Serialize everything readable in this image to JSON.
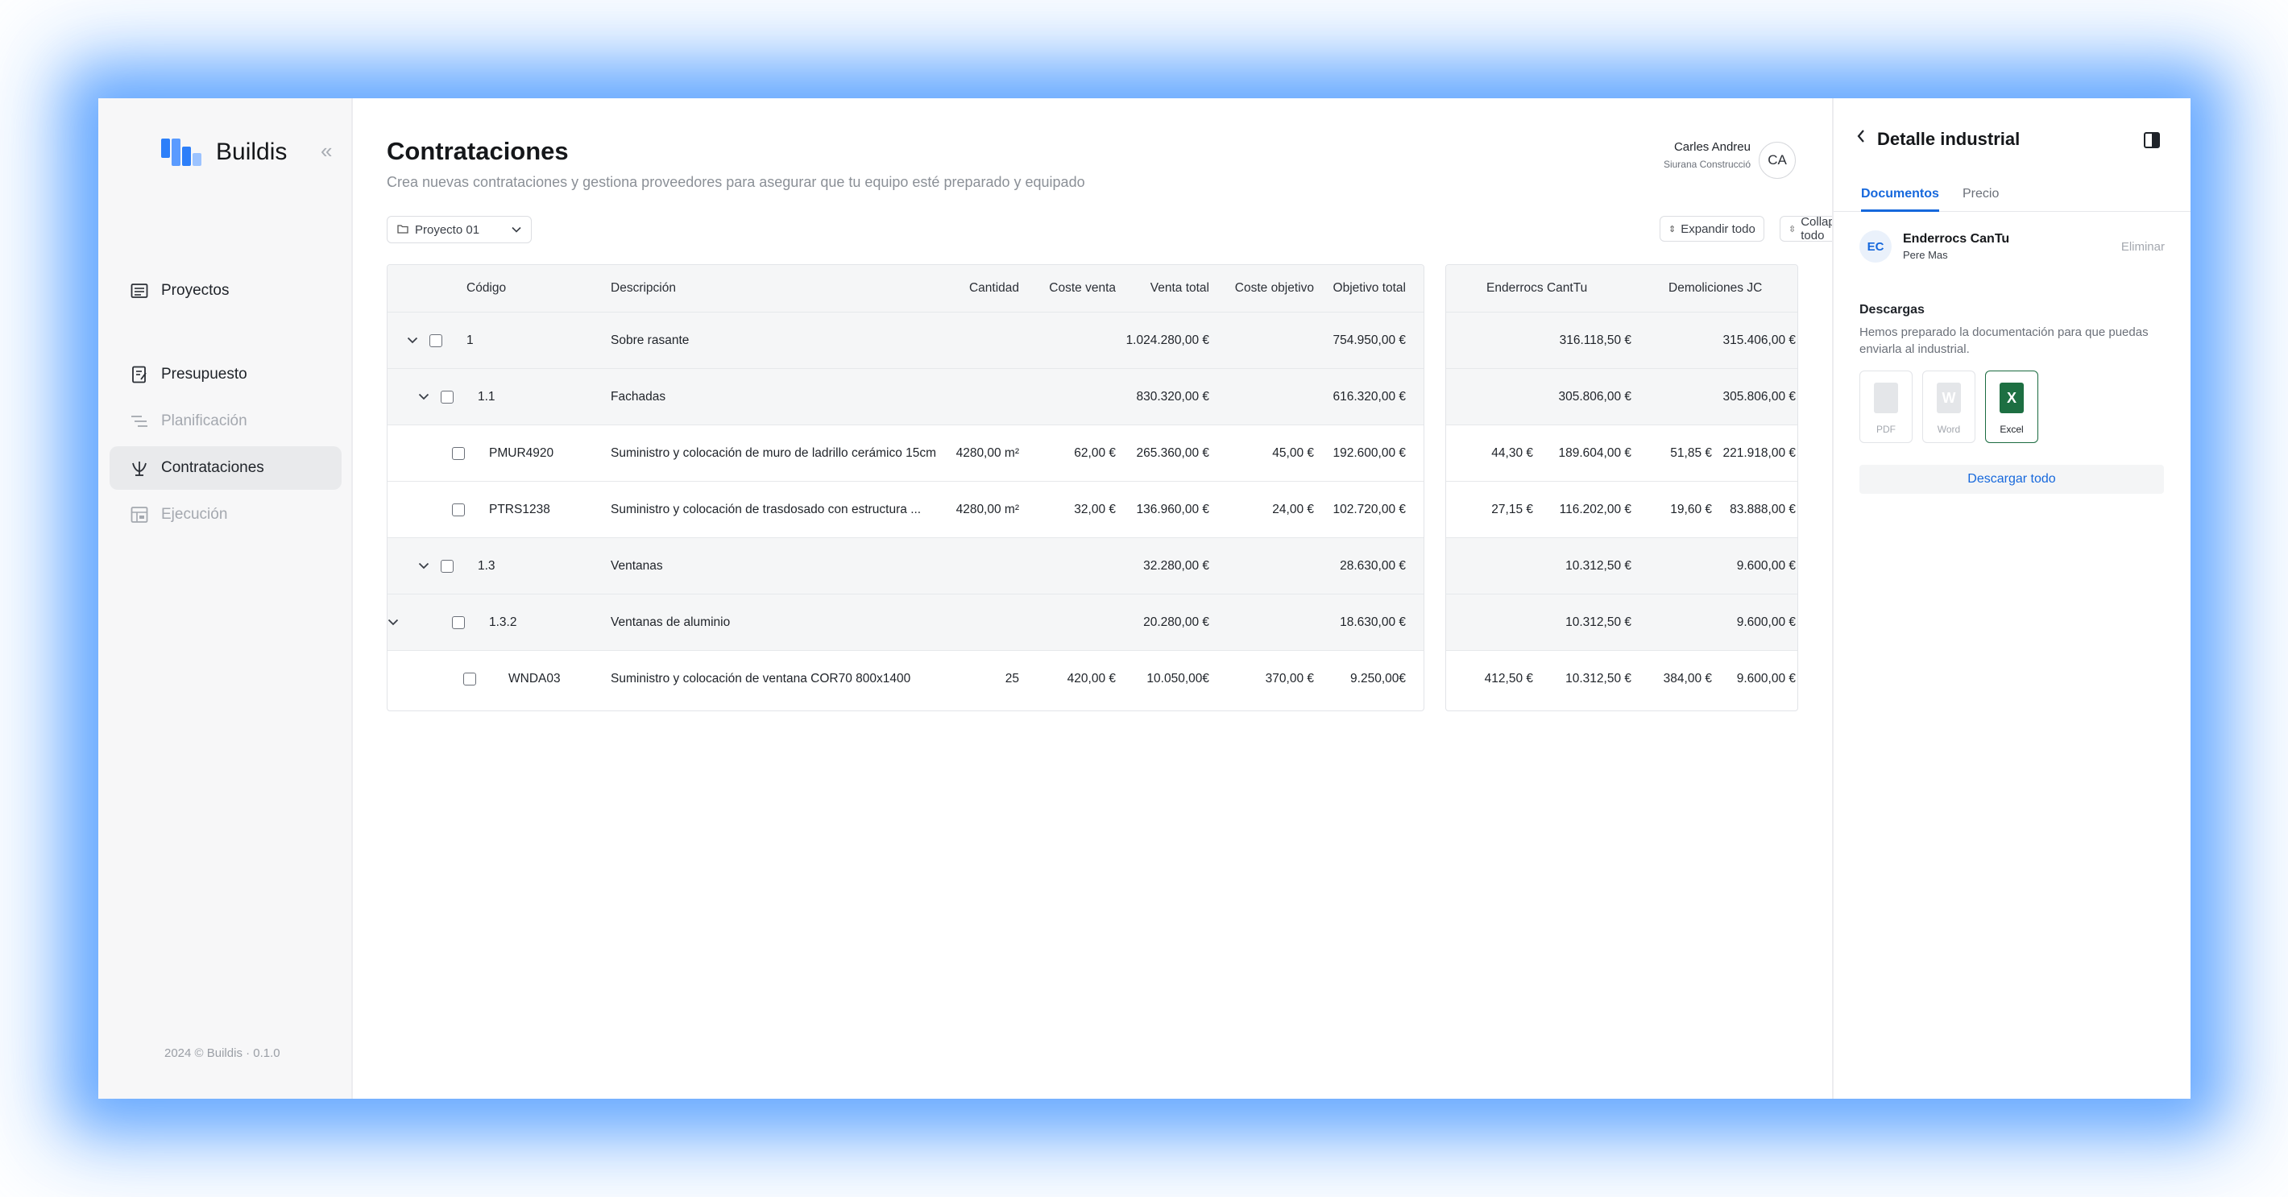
{
  "app": {
    "name": "Buildis",
    "footer": "2024 © Buildis · 0.1.0",
    "collapse_icon": "«"
  },
  "sidebar": {
    "items": [
      {
        "label": "Proyectos",
        "icon": "projects-icon",
        "state": "normal"
      },
      {
        "label": "Presupuesto",
        "icon": "budget-icon",
        "state": "normal"
      },
      {
        "label": "Planificación",
        "icon": "planning-icon",
        "state": "disabled"
      },
      {
        "label": "Contrataciones",
        "icon": "hiring-icon",
        "state": "active"
      },
      {
        "label": "Ejecución",
        "icon": "execution-icon",
        "state": "disabled"
      }
    ]
  },
  "header": {
    "title": "Contrataciones",
    "subtitle": "Crea nuevas contrataciones y gestiona proveedores para asegurar que tu equipo esté preparado y equipado",
    "user_name": "Carles Andreu",
    "user_company": "Siurana Construcció",
    "user_initials": "CA"
  },
  "toolbar": {
    "project": "Proyecto 01",
    "expand_all": "Expandir todo",
    "collapse_all": "Collapsar todo"
  },
  "table": {
    "columns": [
      "Código",
      "Descripción",
      "Cantidad",
      "Coste venta",
      "Venta total",
      "Coste objetivo",
      "Objetivo total"
    ],
    "rows": [
      {
        "code": "1",
        "desc": "Sobre rasante",
        "qty": "",
        "cost": "",
        "total": "1.024.280,00 €",
        "tcost": "",
        "ttotal": "754.950,00 €",
        "group": true,
        "level": 0
      },
      {
        "code": "1.1",
        "desc": "Fachadas",
        "qty": "",
        "cost": "",
        "total": "830.320,00 €",
        "tcost": "",
        "ttotal": "616.320,00 €",
        "group": true,
        "level": 1
      },
      {
        "code": "PMUR4920",
        "desc": "Suministro y colocación de muro de ladrillo cerámico 15cm",
        "qty": "4280,00 m²",
        "cost": "62,00 €",
        "total": "265.360,00 €",
        "tcost": "45,00 €",
        "ttotal": "192.600,00 €",
        "group": false,
        "level": 2
      },
      {
        "code": "PTRS1238",
        "desc": "Suministro y colocación de trasdosado con estructura ...",
        "qty": "4280,00 m²",
        "cost": "32,00 €",
        "total": "136.960,00 €",
        "tcost": "24,00 €",
        "ttotal": "102.720,00 €",
        "group": false,
        "level": 2
      },
      {
        "code": "1.3",
        "desc": "Ventanas",
        "qty": "",
        "cost": "",
        "total": "32.280,00 €",
        "tcost": "",
        "ttotal": "28.630,00 €",
        "group": true,
        "level": 1
      },
      {
        "code": "1.3.2",
        "desc": "Ventanas de aluminio",
        "qty": "",
        "cost": "",
        "total": "20.280,00 €",
        "tcost": "",
        "ttotal": "18.630,00 €",
        "group": true,
        "level": 2
      },
      {
        "code": "WNDA03",
        "desc": "Suministro y colocación de ventana COR70 800x1400",
        "qty": "25",
        "cost": "420,00 €",
        "total": "10.050,00€",
        "tcost": "370,00 €",
        "ttotal": "9.250,00€",
        "group": false,
        "level": 3
      }
    ]
  },
  "suppliers_table": {
    "columns": [
      "Enderrocs CantTu",
      "Demoliciones JC"
    ],
    "rows": [
      {
        "a_unit": "",
        "a_total": "316.118,50 €",
        "b_unit": "",
        "b_total": "315.406,00 €"
      },
      {
        "a_unit": "",
        "a_total": "305.806,00 €",
        "b_unit": "",
        "b_total": "305.806,00 €"
      },
      {
        "a_unit": "44,30 €",
        "a_total": "189.604,00 €",
        "b_unit": "51,85 €",
        "b_total": "221.918,00 €"
      },
      {
        "a_unit": "27,15 €",
        "a_total": "116.202,00 €",
        "b_unit": "19,60 €",
        "b_total": "83.888,00 €"
      },
      {
        "a_unit": "",
        "a_total": "10.312,50 €",
        "b_unit": "",
        "b_total": "9.600,00 €"
      },
      {
        "a_unit": "",
        "a_total": "10.312,50 €",
        "b_unit": "",
        "b_total": "9.600,00 €"
      },
      {
        "a_unit": "412,50 €",
        "a_total": "10.312,50 €",
        "b_unit": "384,00 €",
        "b_total": "9.600,00 €"
      }
    ]
  },
  "panel": {
    "title": "Detalle industrial",
    "tabs": [
      "Documentos",
      "Precio"
    ],
    "supplier_initials": "EC",
    "supplier_name": "Enderrocs CanTu",
    "supplier_contact": "Pere Mas",
    "remove": "Eliminar",
    "downloads_title": "Descargas",
    "downloads_text": "Hemos preparado la documentación para que puedas enviarla al industrial.",
    "files": [
      {
        "label": "PDF",
        "icon": "pdf-file-icon",
        "selected": false
      },
      {
        "label": "Word",
        "icon": "word-file-icon",
        "selected": false
      },
      {
        "label": "Excel",
        "icon": "excel-file-icon",
        "selected": true
      }
    ],
    "download_all": "Descargar todo"
  },
  "colors": {
    "accent": "#1668dc",
    "excel": "#1d6f42",
    "logo": "#2d7ff9"
  }
}
